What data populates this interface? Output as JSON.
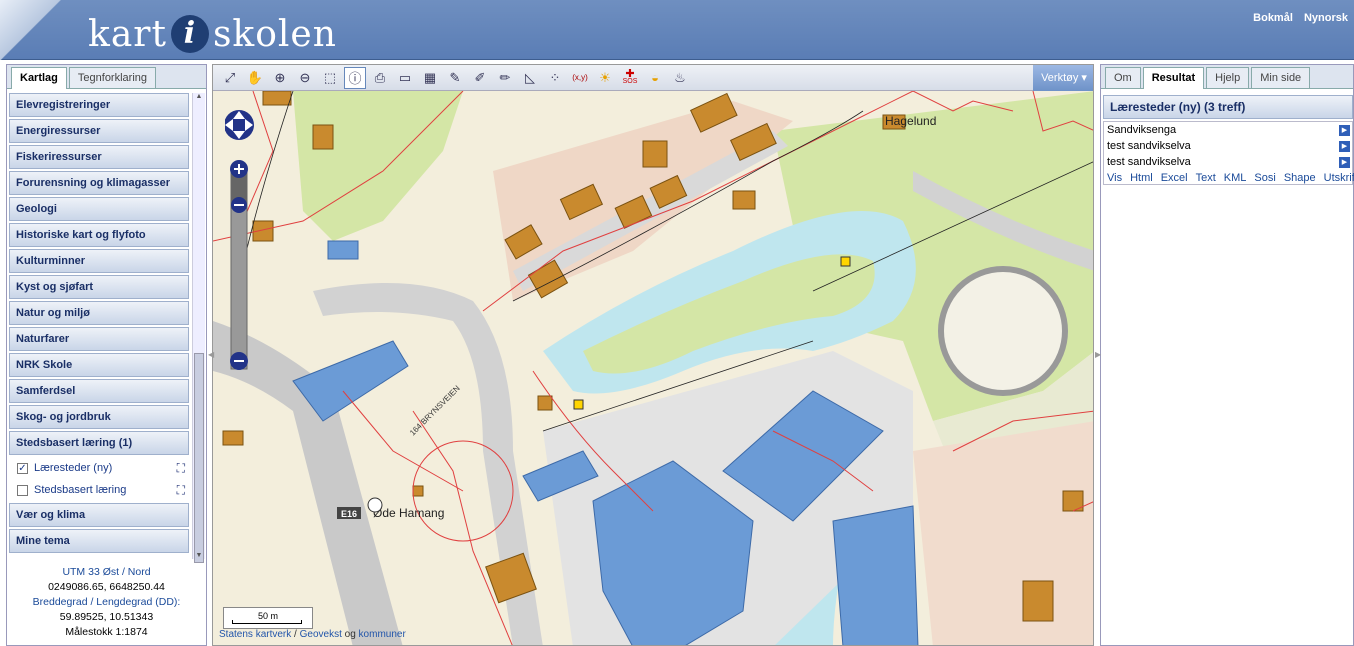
{
  "header": {
    "logo_left": "kart",
    "logo_i": "i",
    "logo_right": "skolen",
    "lang_1": "Bokmål",
    "lang_2": "Nynorsk"
  },
  "left": {
    "tabs": [
      "Kartlag",
      "Tegnforklaring"
    ],
    "layers": [
      "Elevregistreringer",
      "Energiressurser",
      "Fiskeriressurser",
      "Forurensning og klimagasser",
      "Geologi",
      "Historiske kart og flyfoto",
      "Kulturminner",
      "Kyst og sjøfart",
      "Natur og miljø",
      "Naturfarer",
      "NRK Skole",
      "Samferdsel",
      "Skog- og jordbruk",
      "Stedsbasert læring (1)"
    ],
    "sublayers": [
      {
        "label": "Læresteder (ny)",
        "checked": true
      },
      {
        "label": "Stedsbasert læring",
        "checked": false
      }
    ],
    "layers_after": [
      "Vær og klima",
      "Mine tema"
    ],
    "coords": {
      "utm_label": "UTM 33 Øst / Nord",
      "utm_value": "0249086.65, 6648250.44",
      "dd_label": "Breddegrad / Lengdegrad (DD):",
      "dd_value": "59.89525, 10.51343",
      "scale": "Målestokk 1:1874"
    }
  },
  "map": {
    "toolbar_menu": "Verktøy",
    "tool_xy": "(x,y)",
    "tool_sos": "SOS",
    "place_1": "Hagelund",
    "place_2": "Øde Hamang",
    "road_label": "164 BRYNSVEIEN",
    "road_e16": "E16",
    "scale": "50 m",
    "attribution_1": "Statens kartverk",
    "attribution_2": "Geovekst",
    "attribution_3": "og",
    "attribution_4": "kommuner"
  },
  "right": {
    "tabs": [
      "Om",
      "Resultat",
      "Hjelp",
      "Min side"
    ],
    "result_title": "Læresteder (ny) (3 treff)",
    "results": [
      "Sandviksenga",
      "test sandvikselva",
      "test sandvikselva"
    ],
    "export_links": [
      "Vis",
      "Html",
      "Excel",
      "Text",
      "KML",
      "Sosi",
      "Shape"
    ],
    "print_link": "Utskrift"
  },
  "colors": {
    "header_blue": "#5a7db5",
    "building_brown": "#c98a2e",
    "building_blue": "#6b9bd6",
    "river": "#bfe6ee",
    "green": "#d4e6a6"
  }
}
